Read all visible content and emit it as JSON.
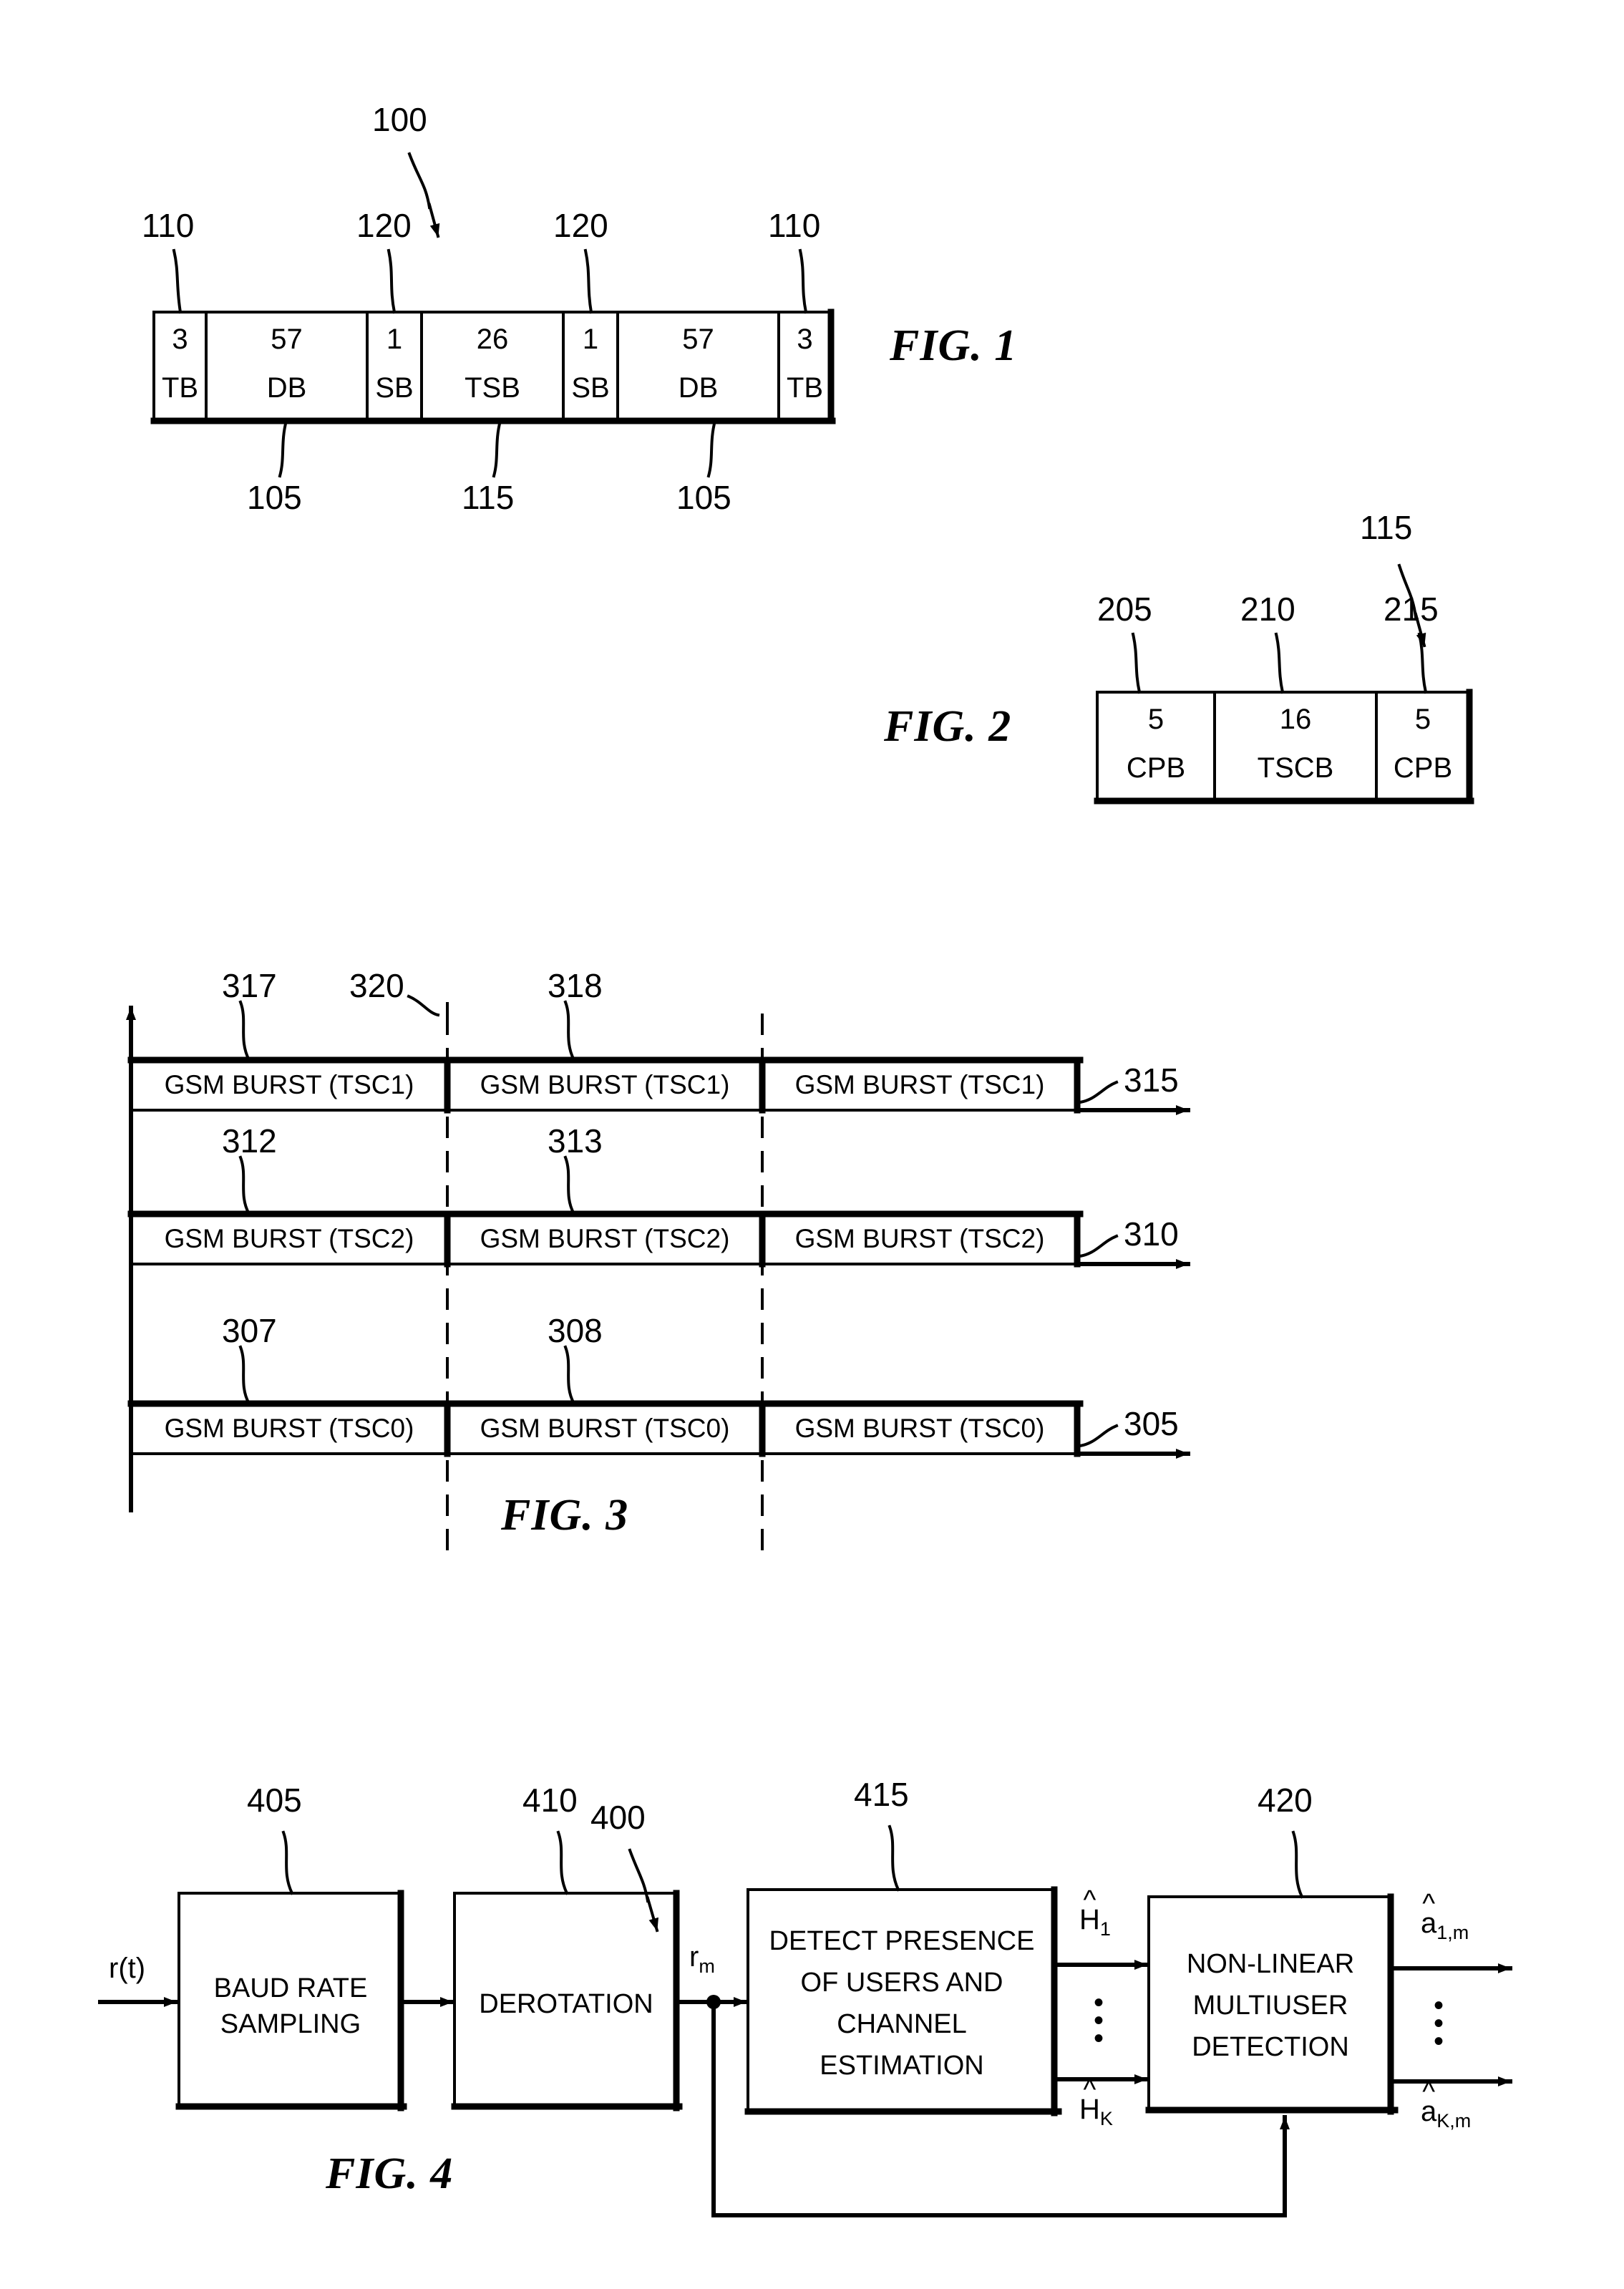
{
  "figures": [
    {
      "id": "fig1",
      "label": "FIG. 1",
      "assembly_ref": "100",
      "cells": [
        {
          "count": "3",
          "name": "TB"
        },
        {
          "count": "57",
          "name": "DB"
        },
        {
          "count": "1",
          "name": "SB"
        },
        {
          "count": "26",
          "name": "TSB"
        },
        {
          "count": "1",
          "name": "SB"
        },
        {
          "count": "57",
          "name": "DB"
        },
        {
          "count": "3",
          "name": "TB"
        }
      ],
      "top_refs": [
        "110",
        "120",
        "120",
        "110"
      ],
      "bottom_refs": [
        "105",
        "115",
        "105"
      ]
    },
    {
      "id": "fig2",
      "label": "FIG. 2",
      "assembly_ref": "115",
      "cells": [
        {
          "count": "5",
          "name": "CPB"
        },
        {
          "count": "16",
          "name": "TSCB"
        },
        {
          "count": "5",
          "name": "CPB"
        }
      ],
      "top_refs": [
        "205",
        "210",
        "215"
      ]
    },
    {
      "id": "fig3",
      "label": "FIG. 3",
      "boundary_ref": "320",
      "rows": [
        {
          "ref": "315",
          "burst_label": "GSM BURST (TSC1)",
          "burst_refs": [
            "317",
            "318"
          ]
        },
        {
          "ref": "310",
          "burst_label": "GSM BURST (TSC2)",
          "burst_refs": [
            "312",
            "313"
          ]
        },
        {
          "ref": "305",
          "burst_label": "GSM BURST (TSC0)",
          "burst_refs": [
            "307",
            "308"
          ]
        }
      ]
    },
    {
      "id": "fig4",
      "label": "FIG. 4",
      "assembly_ref": "400",
      "input_signal": "r(t)",
      "intermediate_signal": {
        "base": "r",
        "sub": "m"
      },
      "blocks": [
        {
          "ref": "405",
          "lines": [
            "BAUD RATE",
            "SAMPLING"
          ]
        },
        {
          "ref": "410",
          "lines": [
            "DEROTATION"
          ]
        },
        {
          "ref": "415",
          "lines": [
            "DETECT PRESENCE",
            "OF USERS AND",
            "CHANNEL",
            "ESTIMATION"
          ]
        },
        {
          "ref": "420",
          "lines": [
            "NON-LINEAR",
            "MULTIUSER",
            "DETECTION"
          ]
        }
      ],
      "channel_signals": [
        {
          "base": "H",
          "sub": "1",
          "hat": "^"
        },
        {
          "base": "H",
          "sub": "K",
          "hat": "^"
        }
      ],
      "output_signals": [
        {
          "base": "a",
          "sub": "1,m",
          "hat": "^"
        },
        {
          "base": "a",
          "sub": "K,m",
          "hat": "^"
        }
      ],
      "vertical_dots": "•"
    }
  ],
  "style": {
    "ink": "#000000",
    "paper": "#ffffff"
  }
}
